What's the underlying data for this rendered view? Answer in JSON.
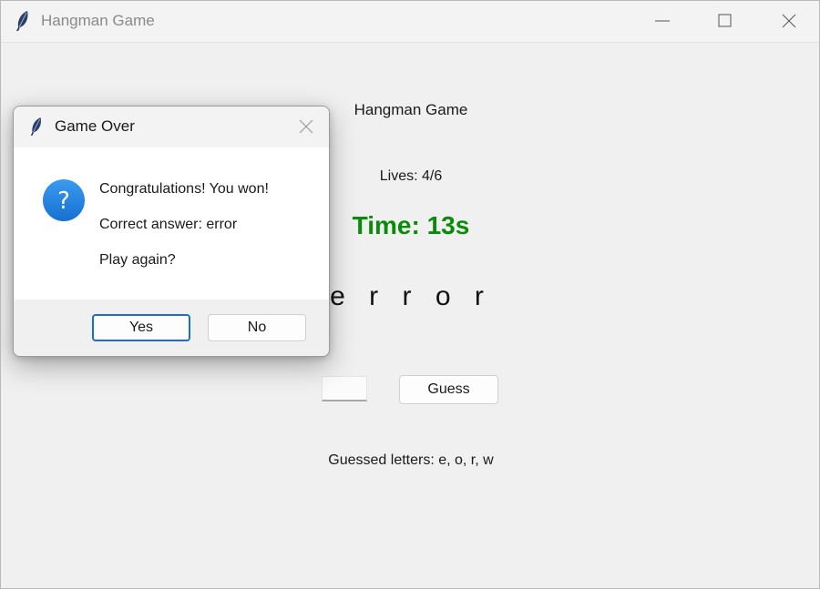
{
  "window": {
    "title": "Hangman Game",
    "icons": {
      "app": "feather-icon",
      "minimize": "minimize-icon",
      "maximize": "maximize-icon",
      "close": "close-icon"
    }
  },
  "game": {
    "heading": "Hangman Game",
    "lives": "Lives: 4/6",
    "timer": "Time: 13s",
    "timer_color": "#0b8a0b",
    "word_display": "e r r o r",
    "guess_input_value": "",
    "guess_button": "Guess",
    "guessed_letters": "Guessed letters: e, o, r, w"
  },
  "dialog": {
    "title": "Game Over",
    "icon": "question-icon",
    "lines": [
      "Congratulations! You won!",
      "Correct answer: error",
      "Play again?"
    ],
    "yes_label": "Yes",
    "no_label": "No",
    "accent_color": "#1a6fcc"
  }
}
